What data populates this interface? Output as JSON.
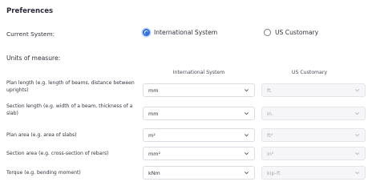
{
  "section_title": "Preferences",
  "current_system": {
    "label": "Current System:",
    "options": [
      {
        "label": "International System",
        "selected": true
      },
      {
        "label": "US Customary",
        "selected": false
      }
    ]
  },
  "units_of_measure": {
    "label": "Units of measure:",
    "columns": [
      "International System",
      "US Customary"
    ],
    "rows": [
      {
        "label": "Plan length (e.g. length of beams, distance between uprights)",
        "si": "mm",
        "us": "ft."
      },
      {
        "label": "Section length (e.g. width of a beam, thickness of a slab)",
        "si": "mm",
        "us": "in."
      },
      {
        "label": "Plan area (e.g. area of slabs)",
        "si": "m²",
        "us": "ft²"
      },
      {
        "label": "Section area (e.g. cross-section of rebars)",
        "si": "mm²",
        "us": "in²"
      },
      {
        "label": "Torque (e.g. bending moment)",
        "si": "kNm",
        "us": "kip-ft"
      }
    ]
  },
  "colors": {
    "accent": "#2f6fe0",
    "disabled_text": "#a6a6b0"
  },
  "icons": {
    "dropdown": "chevron-down-icon"
  }
}
